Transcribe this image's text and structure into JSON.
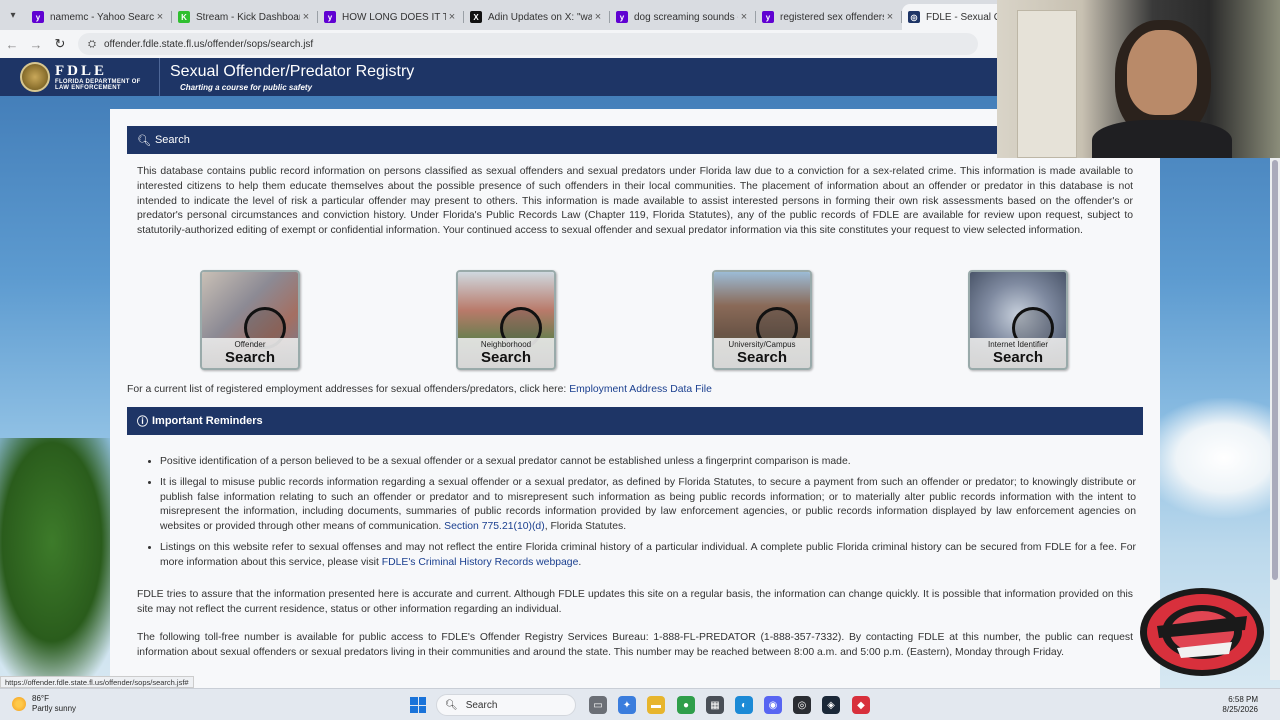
{
  "browser": {
    "tabs": [
      {
        "title": "namemc - Yahoo Search Re",
        "icon": "yahoo-icon",
        "color": "#6001d2"
      },
      {
        "title": "Stream - Kick Dashboard",
        "icon": "kick-icon",
        "color": "#2fbf2f"
      },
      {
        "title": "HOW LONG DOES IT TAKE",
        "icon": "yahoo-icon",
        "color": "#6001d2"
      },
      {
        "title": "Adin Updates on X: \"wait fo",
        "icon": "x-icon",
        "color": "#111111"
      },
      {
        "title": "dog screaming sounds - Ya",
        "icon": "yahoo-icon",
        "color": "#6001d2"
      },
      {
        "title": "registered sex offenders ne",
        "icon": "yahoo-icon",
        "color": "#6001d2"
      },
      {
        "title": "FDLE - Sexual Offend",
        "icon": "fdle-icon",
        "color": "#1e3566",
        "active": true
      }
    ],
    "url": "offender.fdle.state.fl.us/offender/sops/search.jsf",
    "status_url": "https://offender.fdle.state.fl.us/offender/sops/search.jsf#"
  },
  "site": {
    "logo_big": "FDLE",
    "logo_small_1": "FLORIDA DEPARTMENT OF",
    "logo_small_2": "LAW ENFORCEMENT",
    "title": "Sexual Offender/Predator Registry",
    "tagline": "Charting a course for public safety"
  },
  "search_section": {
    "heading": "Search",
    "intro": "This database contains public record information on persons classified as sexual offenders and sexual predators under Florida law due to a conviction for a sex-related crime. This information is made available to interested citizens to help them educate themselves about the possible presence of such offenders in their local communities. The placement of information about an offender or predator in this database is not intended to indicate the level of risk a particular offender may present to others. This information is made available to assist interested persons in forming their own risk assessments based on the offender's or predator's personal circumstances and conviction history. Under Florida's Public Records Law (Chapter 119, Florida Statutes), any of the public records of FDLE are available for review upon request, subject to statutorily-authorized editing of exempt or confidential information. Your continued access to sexual offender and sexual predator information via this site constitutes your request to view selected information.",
    "cards": [
      {
        "line1": "Offender",
        "line2": "Search"
      },
      {
        "line1": "Neighborhood",
        "line2": "Search"
      },
      {
        "line1": "University/Campus",
        "line2": "Search"
      },
      {
        "line1": "Internet Identifier",
        "line2": "Search"
      }
    ],
    "employment_text": "For a current list of registered employment addresses for sexual offenders/predators, click here: ",
    "employment_link": "Employment Address Data File"
  },
  "reminders": {
    "heading": "Important Reminders",
    "item1": "Positive identification of a person believed to be a sexual offender or a sexual predator cannot be established unless a fingerprint comparison is made.",
    "item2_text": "It is illegal to misuse public records information regarding a sexual offender or a sexual predator, as defined by Florida Statutes, to secure a payment from such an offender or predator; to knowingly distribute or publish false information relating to such an offender or predator and to misrepresent such information as being public records information; or to materially alter public records information with the intent to misrepresent the information, including documents, summaries of public records information provided by law enforcement agencies, or public records information displayed by law enforcement agencies on websites or provided through other means of communication. ",
    "item2_link": "Section 775.21(10)(d)",
    "item2_tail": ", Florida Statutes.",
    "item3_text": "Listings on this website refer to sexual offenses and may not reflect the entire Florida criminal history of a particular individual. A complete public Florida criminal history can be secured from FDLE for a fee. For more information about this service, please visit ",
    "item3_link": "FDLE's Criminal History Records webpage",
    "item3_tail": ".",
    "accuracy": "FDLE tries to assure that the information presented here is accurate and current. Although FDLE updates this site on a regular basis, the information can change quickly. It is possible that information provided on this site may not reflect the current residence, status or other information regarding an individual.",
    "phone": "The following toll-free number is available for public access to FDLE's Offender Registry Services Bureau: 1-888-FL-PREDATOR (1-888-357-7332). By contacting FDLE at this number, the public can request information about sexual offenders or sexual predators living in their communities and around the state. This number may be reached between 8:00 a.m. and 5:00 p.m. (Eastern), Monday through Friday."
  },
  "taskbar": {
    "temp": "86°F",
    "weather": "Partly sunny",
    "search_label": "Search",
    "time": "6:58 PM",
    "date": "8/25/2026"
  }
}
